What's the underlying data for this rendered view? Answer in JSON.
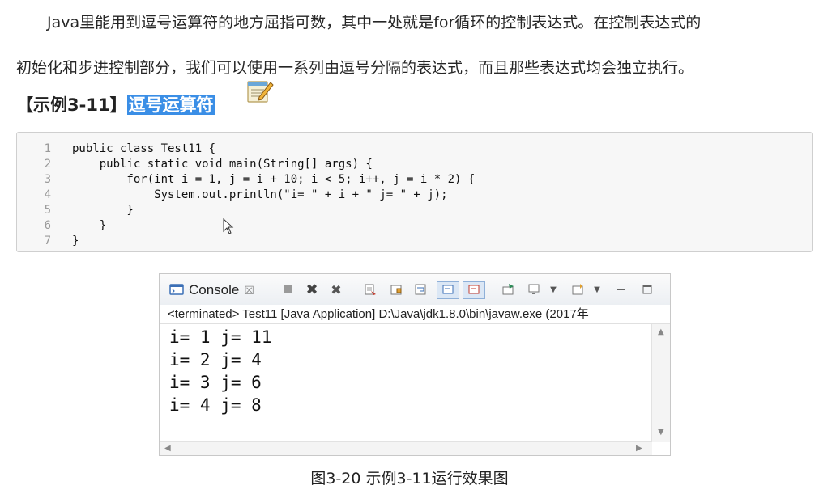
{
  "paragraph": {
    "line1": "Java里能用到逗号运算符的地方屈指可数，其中一处就是for循环的控制表达式。在控制表达式的",
    "line2": "初始化和步进控制部分，我们可以使用一系列由逗号分隔的表达式，而且那些表达式均会独立执行。"
  },
  "heading": {
    "prefix": "【示例3-11】",
    "highlight": "逗号运算符"
  },
  "code": {
    "line_numbers": [
      "1",
      "2",
      "3",
      "4",
      "5",
      "6",
      "7"
    ],
    "lines": [
      "public class Test11 {",
      "    public static void main(String[] args) {",
      "        for(int i = 1, j = i + 10; i < 5; i++, j = i * 2) {",
      "            System.out.println(\"i= \" + i + \" j= \" + j);",
      "        }",
      "    }",
      "}"
    ]
  },
  "console": {
    "tab_label": "Console",
    "tab_close": "☒",
    "status": "<terminated> Test11 [Java Application] D:\\Java\\jdk1.8.0\\bin\\javaw.exe (2017年",
    "output": [
      "i= 1 j= 11",
      "i= 2 j= 4",
      "i= 3 j= 6",
      "i= 4 j= 8"
    ]
  },
  "caption": "图3-20 示例3-11运行效果图",
  "colors": {
    "highlight": "#3a8ee6",
    "code_background": "#f7f7f7"
  }
}
